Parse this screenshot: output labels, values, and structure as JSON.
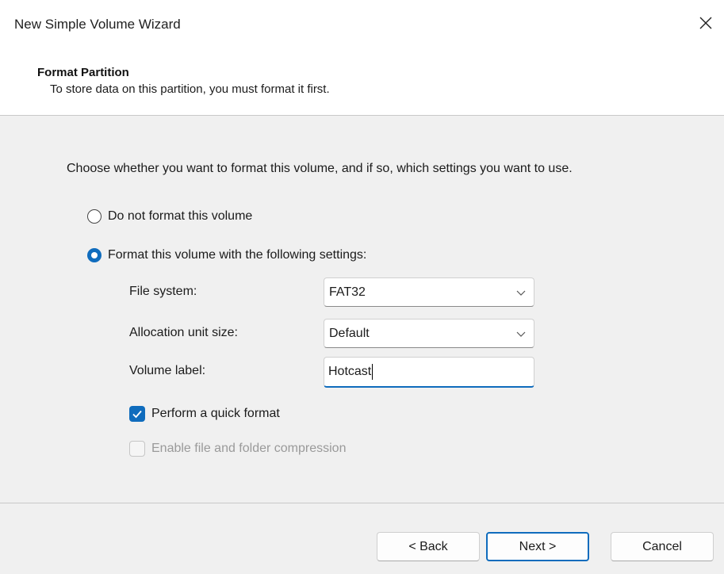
{
  "window": {
    "title": "New Simple Volume Wizard",
    "close_icon": "close-icon"
  },
  "header": {
    "title": "Format Partition",
    "subtitle": "To store data on this partition, you must format it first."
  },
  "content": {
    "intro": "Choose whether you want to format this volume, and if so, which settings you want to use.",
    "options": [
      {
        "label": "Do not format this volume",
        "selected": false
      },
      {
        "label": "Format this volume with the following settings:",
        "selected": true
      }
    ],
    "fields": {
      "file_system": {
        "label": "File system:",
        "value": "FAT32"
      },
      "allocation_unit_size": {
        "label": "Allocation unit size:",
        "value": "Default"
      },
      "volume_label": {
        "label": "Volume label:",
        "value": "Hotcast"
      }
    },
    "checkboxes": [
      {
        "label": "Perform a quick format",
        "checked": true,
        "enabled": true
      },
      {
        "label": "Enable file and folder compression",
        "checked": false,
        "enabled": false
      }
    ]
  },
  "footer": {
    "back_label": "< Back",
    "next_label": "Next >",
    "cancel_label": "Cancel"
  },
  "colors": {
    "accent": "#0f6cbd",
    "panel_bg": "#f0f0f0",
    "disabled_text": "#9a9a9a"
  }
}
